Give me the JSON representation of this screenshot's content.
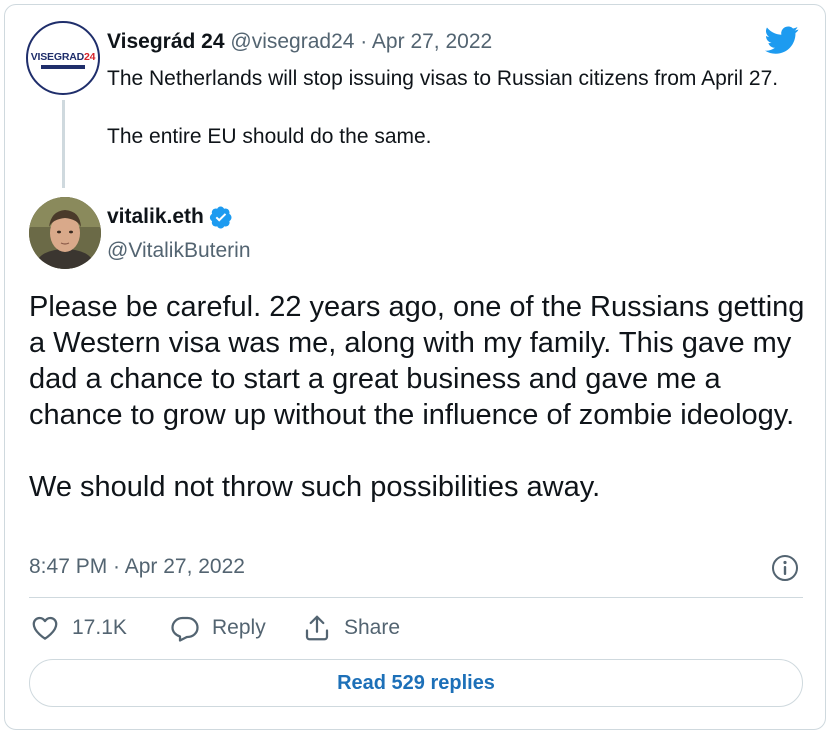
{
  "quoted_tweet": {
    "name": "Visegrád 24",
    "meta": "@visegrad24 · Apr 27, 2022",
    "text": "The Netherlands will stop issuing visas to Russian citizens from April 27.\n\nThe entire EU should do the same.",
    "avatar_text": "VISEGRAD",
    "avatar_number": "24"
  },
  "main_tweet": {
    "name": "vitalik.eth",
    "handle": "@VitalikButerin",
    "verified": true,
    "text": "Please be careful. 22 years ago, one of the Russians getting a Western visa was me, along with my family. This gave my dad a chance to start a great business and gave me a chance to grow up without the influence of zombie ideology.\n\nWe should not throw such possibilities away.",
    "timestamp": "8:47 PM · Apr 27, 2022"
  },
  "actions": {
    "like_count": "17.1K",
    "reply_label": "Reply",
    "share_label": "Share"
  },
  "read_replies_label": "Read 529 replies",
  "colors": {
    "twitter_blue": "#1d9bf0",
    "link_blue": "#1d70b8",
    "secondary_text": "#536471",
    "border": "#cfd9de"
  },
  "icons": [
    "twitter-bird-icon",
    "verified-badge-icon",
    "info-icon",
    "heart-icon",
    "reply-icon",
    "share-icon"
  ]
}
